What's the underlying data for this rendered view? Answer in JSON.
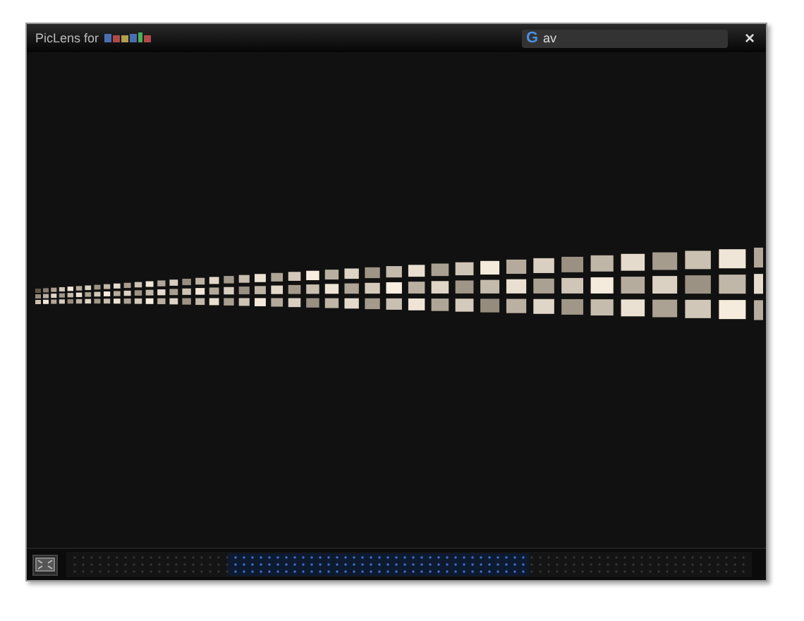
{
  "window": {
    "title": "PicLens for"
  },
  "search": {
    "value": "av",
    "icon": "G"
  },
  "close_button": {
    "label": "×"
  }
}
